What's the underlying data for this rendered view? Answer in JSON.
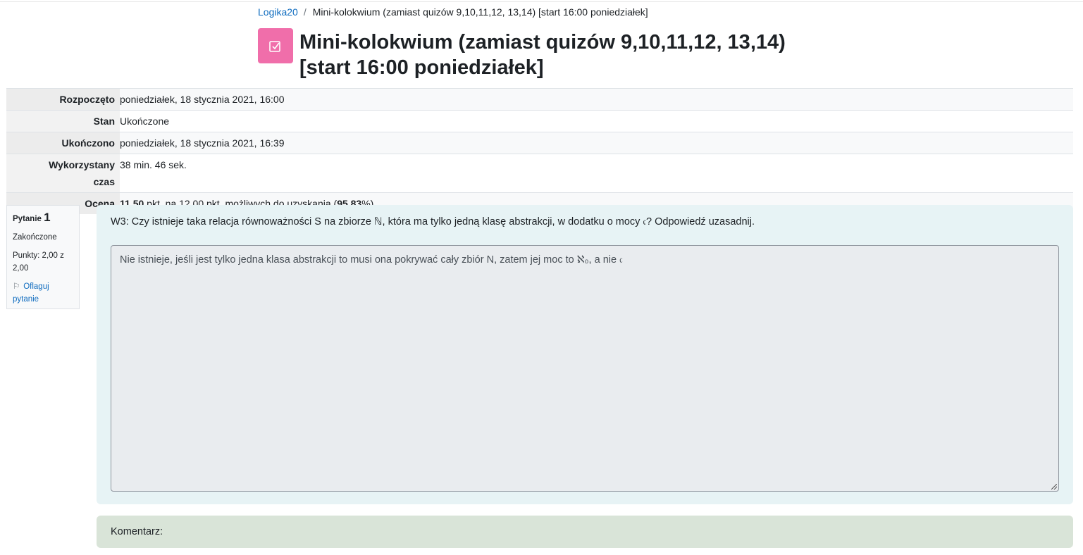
{
  "breadcrumb": {
    "course": "Logika20",
    "separator": "/",
    "current": "Mini-kolokwium (zamiast quizów 9,10,11,12, 13,14) [start 16:00 poniedziałek]"
  },
  "header": {
    "icon": "quiz-checkbox-icon",
    "icon_color": "#f06eaa",
    "title_line1": "Mini-kolokwium (zamiast quizów 9,10,11,12, 13,14)",
    "title_line2": "[start 16:00 poniedziałek]"
  },
  "summary": {
    "started_label": "Rozpoczęto",
    "started_value": "poniedziałek, 18 stycznia 2021, 16:00",
    "state_label": "Stan",
    "state_value": "Ukończone",
    "completed_label": "Ukończono",
    "completed_value": "poniedziałek, 18 stycznia 2021, 16:39",
    "time_label_1": "Wykorzystany",
    "time_label_2": "czas",
    "time_value": "38 min. 46 sek.",
    "grade_label": "Ocena",
    "grade_points": "11,50",
    "grade_mid": " pkt. na 12,00 pkt. możliwych do uzyskania (",
    "grade_percent": "95,83",
    "grade_end": "%)"
  },
  "question": {
    "label": "Pytanie",
    "number": "1",
    "state": "Zakończone",
    "marks": "Punkty: 2,00 z 2,00",
    "flag_icon": "flag-icon",
    "flag_label": "Oflaguj pytanie",
    "text": "W3: Czy istnieje taka relacja równoważności S na zbiorze ℕ, która ma tylko jedną klasę abstrakcji, w dodatku o mocy 𝔠? Odpowiedź uzasadnij.",
    "answer": "Nie istnieje, jeśli jest tylko jedna klasa abstrakcji to musi ona pokrywać cały zbiór N, zatem jej moc to ℵ₀, a nie 𝔠"
  },
  "comment": {
    "label": "Komentarz:"
  }
}
